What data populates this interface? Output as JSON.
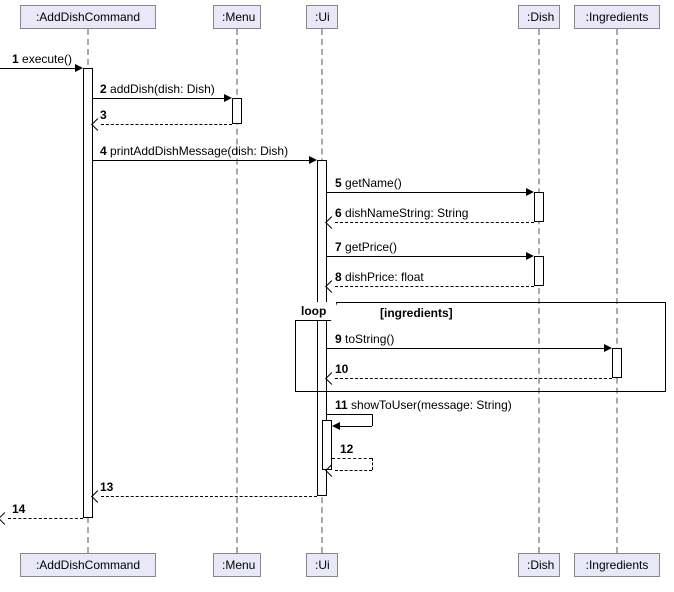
{
  "participants": {
    "adddishcommand": ":AddDishCommand",
    "menu": ":Menu",
    "ui": ":Ui",
    "dish": ":Dish",
    "ingredients": ":Ingredients"
  },
  "messages": {
    "m1_num": "1",
    "m1_text": "execute()",
    "m2_num": "2",
    "m2_text": "addDish(dish: Dish)",
    "m3_num": "3",
    "m3_text": "",
    "m4_num": "4",
    "m4_text": "printAddDishMessage(dish: Dish)",
    "m5_num": "5",
    "m5_text": "getName()",
    "m6_num": "6",
    "m6_text": "dishNameString: String",
    "m7_num": "7",
    "m7_text": "getPrice()",
    "m8_num": "8",
    "m8_text": "dishPrice: float",
    "m9_num": "9",
    "m9_text": "toString()",
    "m10_num": "10",
    "m10_text": "",
    "m11_num": "11",
    "m11_text": "showToUser(message: String)",
    "m12_num": "12",
    "m12_text": "",
    "m13_num": "13",
    "m13_text": "",
    "m14_num": "14",
    "m14_text": ""
  },
  "loop": {
    "label": "loop",
    "guard": "[ingredients]"
  },
  "chart_data": {
    "type": "sequence-diagram",
    "participants": [
      ":AddDishCommand",
      ":Menu",
      ":Ui",
      ":Dish",
      ":Ingredients"
    ],
    "interactions": [
      {
        "n": 1,
        "from": "(caller)",
        "to": ":AddDishCommand",
        "name": "execute()",
        "kind": "sync"
      },
      {
        "n": 2,
        "from": ":AddDishCommand",
        "to": ":Menu",
        "name": "addDish(dish: Dish)",
        "kind": "sync"
      },
      {
        "n": 3,
        "from": ":Menu",
        "to": ":AddDishCommand",
        "name": "",
        "kind": "return"
      },
      {
        "n": 4,
        "from": ":AddDishCommand",
        "to": ":Ui",
        "name": "printAddDishMessage(dish: Dish)",
        "kind": "sync"
      },
      {
        "n": 5,
        "from": ":Ui",
        "to": ":Dish",
        "name": "getName()",
        "kind": "sync"
      },
      {
        "n": 6,
        "from": ":Dish",
        "to": ":Ui",
        "name": "dishNameString: String",
        "kind": "return"
      },
      {
        "n": 7,
        "from": ":Ui",
        "to": ":Dish",
        "name": "getPrice()",
        "kind": "sync"
      },
      {
        "n": 8,
        "from": ":Dish",
        "to": ":Ui",
        "name": "dishPrice: float",
        "kind": "return"
      },
      {
        "n": 9,
        "from": ":Ui",
        "to": ":Ingredients",
        "name": "toString()",
        "kind": "sync",
        "fragment": "loop",
        "guard": "[ingredients]"
      },
      {
        "n": 10,
        "from": ":Ingredients",
        "to": ":Ui",
        "name": "",
        "kind": "return",
        "fragment": "loop",
        "guard": "[ingredients]"
      },
      {
        "n": 11,
        "from": ":Ui",
        "to": ":Ui",
        "name": "showToUser(message: String)",
        "kind": "self-sync"
      },
      {
        "n": 12,
        "from": ":Ui",
        "to": ":Ui",
        "name": "",
        "kind": "self-return"
      },
      {
        "n": 13,
        "from": ":Ui",
        "to": ":AddDishCommand",
        "name": "",
        "kind": "return"
      },
      {
        "n": 14,
        "from": ":AddDishCommand",
        "to": "(caller)",
        "name": "",
        "kind": "return"
      }
    ]
  }
}
